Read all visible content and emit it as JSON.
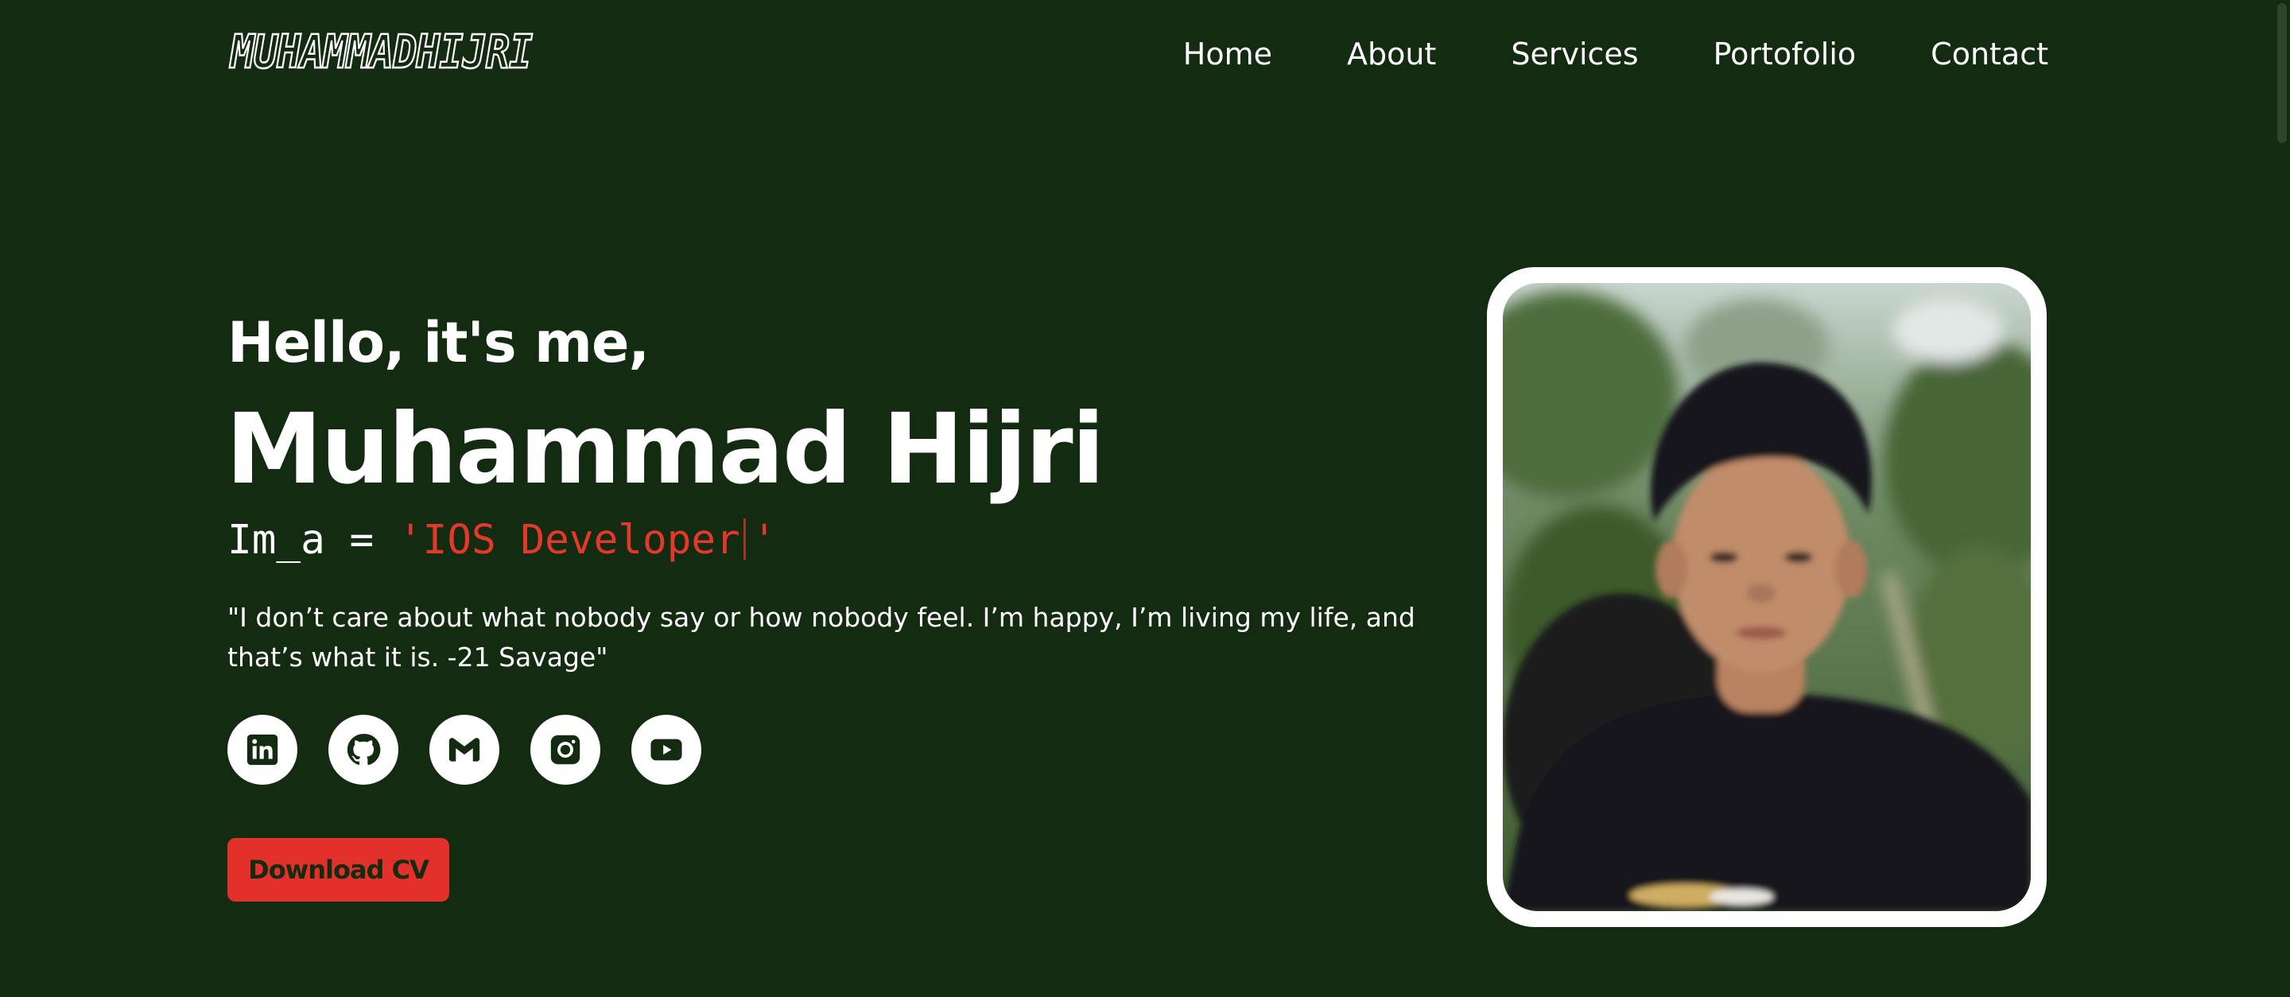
{
  "logo": {
    "text": "MUHAMMADHIJRI"
  },
  "nav": {
    "items": [
      {
        "label": "Home"
      },
      {
        "label": "About"
      },
      {
        "label": "Services"
      },
      {
        "label": "Portofolio"
      },
      {
        "label": "Contact"
      }
    ]
  },
  "hero": {
    "greeting": "Hello, it's me,",
    "name": "Muhammad Hijri",
    "code_prefix": "Im_a = ",
    "code_value": "'IOS Developer",
    "code_close": "'",
    "quote": "\"I don’t care about what nobody say or how nobody feel. I’m happy, I’m living my life, and that’s what it is. -21 Savage\"",
    "download_label": "Download CV"
  },
  "socials": [
    {
      "icon": "linkedin-icon"
    },
    {
      "icon": "github-icon"
    },
    {
      "icon": "gmail-icon"
    },
    {
      "icon": "instagram-icon"
    },
    {
      "icon": "youtube-icon"
    }
  ],
  "colors": {
    "background": "#132b10",
    "accent": "#e4302a",
    "text": "#ffffff"
  }
}
